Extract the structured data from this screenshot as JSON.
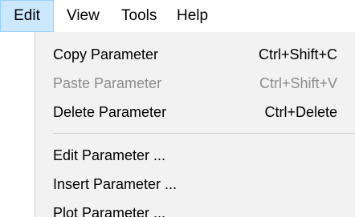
{
  "menubar": {
    "items": [
      {
        "label": "Edit",
        "active": true
      },
      {
        "label": "View"
      },
      {
        "label": "Tools"
      },
      {
        "label": "Help"
      }
    ]
  },
  "dropdown": {
    "items": [
      {
        "label": "Copy Parameter",
        "shortcut": "Ctrl+Shift+C",
        "enabled": true
      },
      {
        "label": "Paste Parameter",
        "shortcut": "Ctrl+Shift+V",
        "enabled": false
      },
      {
        "label": "Delete Parameter",
        "shortcut": "Ctrl+Delete",
        "enabled": true
      },
      {
        "label": "Edit Parameter ...",
        "shortcut": "",
        "enabled": true
      },
      {
        "label": "Insert Parameter ...",
        "shortcut": "",
        "enabled": true
      },
      {
        "label": "Plot Parameter ...",
        "shortcut": "",
        "enabled": true
      }
    ]
  },
  "colors": {
    "active_menu_bg": "#cce8ff",
    "active_menu_border": "#99d1ff",
    "dropdown_bg": "#f2f2f2",
    "disabled_text": "#8c8c8c"
  }
}
